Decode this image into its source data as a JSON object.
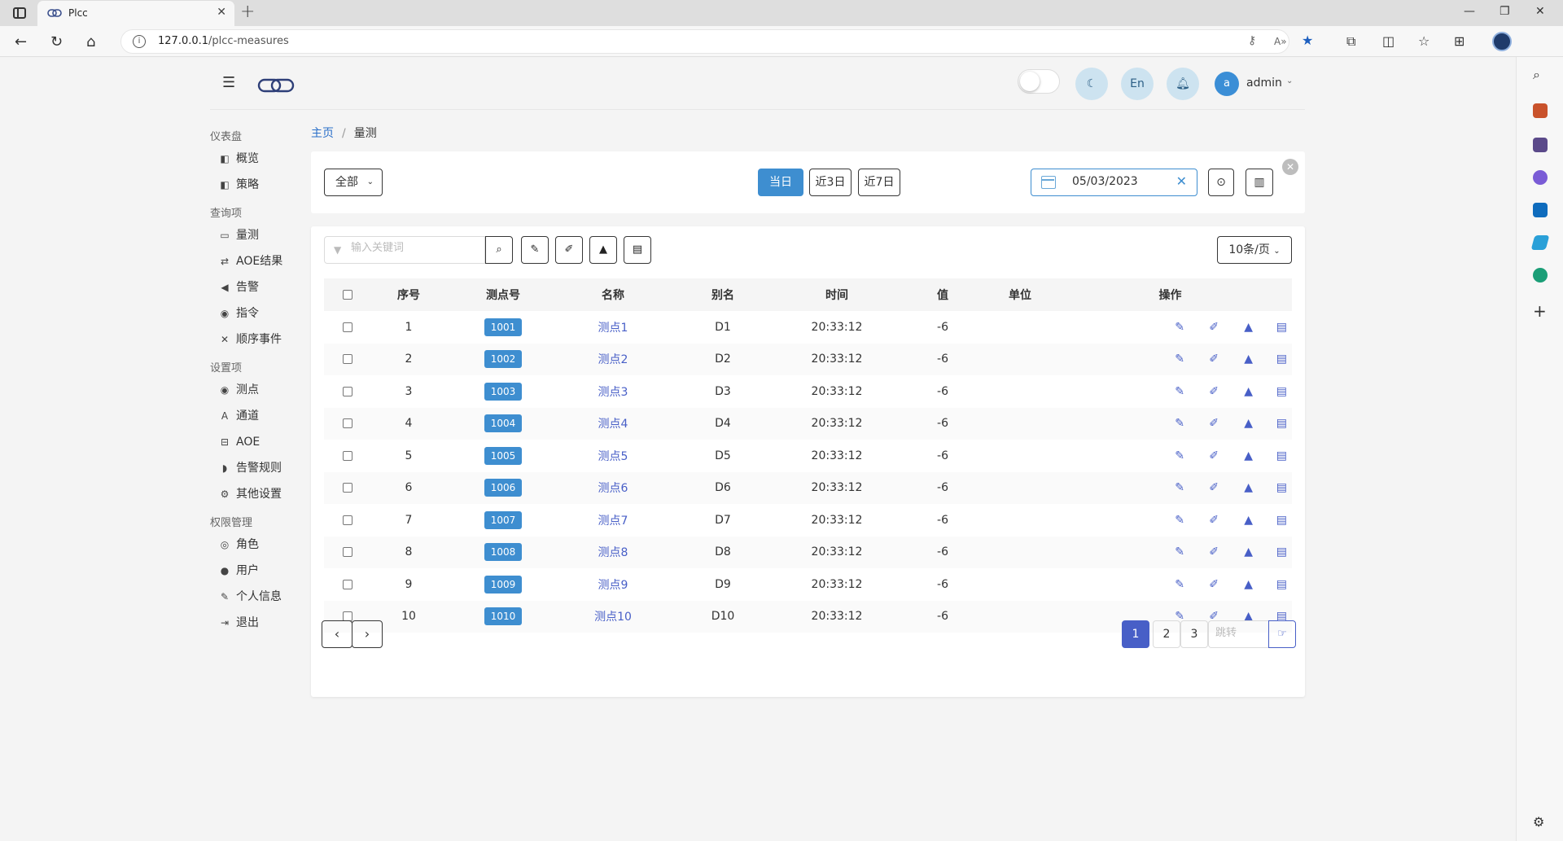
{
  "browser": {
    "tab_title": "Plcc",
    "url_host": "127.0.0.1",
    "url_path": "/plcc-measures"
  },
  "header": {
    "lang_label": "En",
    "user_initial": "a",
    "user_name": "admin"
  },
  "menu": {
    "groups": [
      {
        "label": "仪表盘",
        "items": [
          {
            "label": "概览",
            "icon": "dashboard-icon"
          },
          {
            "label": "策略",
            "icon": "dashboard-icon"
          }
        ]
      },
      {
        "label": "查询项",
        "items": [
          {
            "label": "量测",
            "icon": "monitor-icon"
          },
          {
            "label": "AOE结果",
            "icon": "retweet-icon"
          },
          {
            "label": "告警",
            "icon": "bullhorn-icon"
          },
          {
            "label": "指令",
            "icon": "podcast-icon"
          },
          {
            "label": "顺序事件",
            "icon": "random-icon"
          }
        ]
      },
      {
        "label": "设置项",
        "items": [
          {
            "label": "测点",
            "icon": "podcast-icon"
          },
          {
            "label": "通道",
            "icon": "road-icon"
          },
          {
            "label": "AOE",
            "icon": "sitemap-icon"
          },
          {
            "label": "告警规则",
            "icon": "shield-icon"
          },
          {
            "label": "其他设置",
            "icon": "cogs-icon"
          }
        ]
      },
      {
        "label": "权限管理",
        "items": [
          {
            "label": "角色",
            "icon": "user-circle-icon"
          },
          {
            "label": "用户",
            "icon": "users-icon"
          },
          {
            "label": "个人信息",
            "icon": "edit-icon"
          },
          {
            "label": "退出",
            "icon": "sign-out-icon"
          }
        ]
      }
    ]
  },
  "breadcrumb": {
    "home": "主页",
    "separator": "/",
    "current": "量测"
  },
  "filter": {
    "scope_select": "全部",
    "btn_today": "当日",
    "btn_3days": "近3日",
    "btn_7days": "近7日",
    "date_value": "05/03/2023"
  },
  "toolbar": {
    "search_placeholder": "输入关键词",
    "page_size": "10条/页"
  },
  "table": {
    "columns": [
      "序号",
      "测点号",
      "名称",
      "别名",
      "时间",
      "值",
      "单位",
      "操作"
    ],
    "rows": [
      {
        "idx": "1",
        "point": "1001",
        "name": "测点1",
        "alias": "D1",
        "time": "20:33:12",
        "value": "-6",
        "unit": ""
      },
      {
        "idx": "2",
        "point": "1002",
        "name": "测点2",
        "alias": "D2",
        "time": "20:33:12",
        "value": "-6",
        "unit": ""
      },
      {
        "idx": "3",
        "point": "1003",
        "name": "测点3",
        "alias": "D3",
        "time": "20:33:12",
        "value": "-6",
        "unit": ""
      },
      {
        "idx": "4",
        "point": "1004",
        "name": "测点4",
        "alias": "D4",
        "time": "20:33:12",
        "value": "-6",
        "unit": ""
      },
      {
        "idx": "5",
        "point": "1005",
        "name": "测点5",
        "alias": "D5",
        "time": "20:33:12",
        "value": "-6",
        "unit": ""
      },
      {
        "idx": "6",
        "point": "1006",
        "name": "测点6",
        "alias": "D6",
        "time": "20:33:12",
        "value": "-6",
        "unit": ""
      },
      {
        "idx": "7",
        "point": "1007",
        "name": "测点7",
        "alias": "D7",
        "time": "20:33:12",
        "value": "-6",
        "unit": ""
      },
      {
        "idx": "8",
        "point": "1008",
        "name": "测点8",
        "alias": "D8",
        "time": "20:33:12",
        "value": "-6",
        "unit": ""
      },
      {
        "idx": "9",
        "point": "1009",
        "name": "测点9",
        "alias": "D9",
        "time": "20:33:12",
        "value": "-6",
        "unit": ""
      },
      {
        "idx": "10",
        "point": "1010",
        "name": "测点10",
        "alias": "D10",
        "time": "20:33:12",
        "value": "-6",
        "unit": ""
      }
    ]
  },
  "pagination": {
    "pages": [
      "1",
      "2",
      "3"
    ],
    "current": "1",
    "jump_placeholder": "跳转"
  },
  "colors": {
    "primary": "#3e8ed0",
    "link": "#485fc7"
  }
}
